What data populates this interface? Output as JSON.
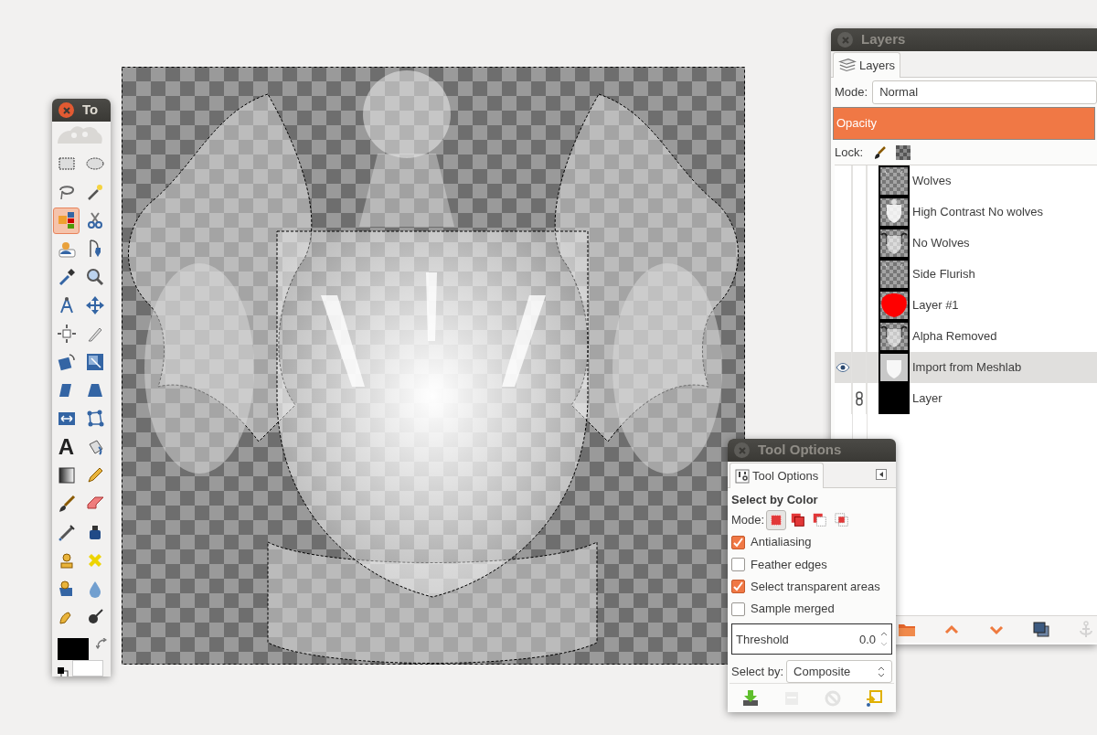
{
  "toolbox": {
    "title": "To",
    "active": true,
    "tools": [
      {
        "kind": "rect_select",
        "selected": false
      },
      {
        "kind": "ellipse_select",
        "selected": false
      },
      {
        "kind": "free_select",
        "selected": false
      },
      {
        "kind": "fuzzy_select",
        "selected": false
      },
      {
        "kind": "by_color_select",
        "selected": true
      },
      {
        "kind": "scissors",
        "selected": false
      },
      {
        "kind": "foreground_select",
        "selected": false
      },
      {
        "kind": "paths",
        "selected": false
      },
      {
        "kind": "color_picker",
        "selected": false
      },
      {
        "kind": "zoom",
        "selected": false
      },
      {
        "kind": "measure",
        "selected": false
      },
      {
        "kind": "move",
        "selected": false
      },
      {
        "kind": "align",
        "selected": false
      },
      {
        "kind": "crop",
        "selected": false
      },
      {
        "kind": "rotate",
        "selected": false
      },
      {
        "kind": "scale",
        "selected": false
      },
      {
        "kind": "shear",
        "selected": false
      },
      {
        "kind": "perspective",
        "selected": false
      },
      {
        "kind": "flip",
        "selected": false
      },
      {
        "kind": "cage",
        "selected": false
      },
      {
        "kind": "text",
        "glyph": "A",
        "selected": false
      },
      {
        "kind": "bucket_fill",
        "selected": false
      },
      {
        "kind": "blend",
        "selected": false
      },
      {
        "kind": "pencil",
        "selected": false
      },
      {
        "kind": "paintbrush",
        "selected": false
      },
      {
        "kind": "eraser",
        "selected": false
      },
      {
        "kind": "airbrush",
        "selected": false
      },
      {
        "kind": "ink",
        "selected": false
      },
      {
        "kind": "clone",
        "selected": false
      },
      {
        "kind": "heal",
        "selected": false
      },
      {
        "kind": "perspective_clone",
        "selected": false
      },
      {
        "kind": "blur",
        "selected": false
      },
      {
        "kind": "smudge",
        "selected": false
      },
      {
        "kind": "dodge_burn",
        "selected": false
      }
    ],
    "colors": [
      {
        "kind": "foreground",
        "color": "#000000"
      },
      {
        "kind": "background",
        "color": "#ffffff"
      }
    ]
  },
  "layers_window": {
    "title": "Layers",
    "active": false,
    "tabs": [
      {
        "label": "Layers",
        "selected": true
      }
    ],
    "mode_label": "Mode:",
    "mode": "Normal",
    "opacity": {
      "label": "Opacity",
      "level": 1
    },
    "lock_label": "Lock:",
    "layers": [
      {
        "name": "Wolves",
        "visible": false,
        "linked": false,
        "selected": false
      },
      {
        "name": "High Contrast No wolves",
        "visible": false,
        "linked": false,
        "selected": false
      },
      {
        "name": "No Wolves",
        "visible": false,
        "linked": false,
        "selected": false
      },
      {
        "name": "Side Flurish",
        "visible": false,
        "linked": false,
        "selected": false
      },
      {
        "name": "Layer #1",
        "visible": false,
        "linked": false,
        "selected": false
      },
      {
        "name": "Alpha Removed",
        "visible": false,
        "linked": false,
        "selected": false
      },
      {
        "name": "Import from Meshlab",
        "visible": true,
        "linked": false,
        "selected": true
      },
      {
        "name": "Layer",
        "visible": false,
        "linked": true,
        "selected": false
      }
    ],
    "buttons": [
      {
        "kind": "folder",
        "disabled": false
      },
      {
        "kind": "raise",
        "disabled": false
      },
      {
        "kind": "lower",
        "disabled": false
      },
      {
        "kind": "duplicate",
        "disabled": false
      },
      {
        "kind": "anchor",
        "disabled": true
      }
    ]
  },
  "tool_options": {
    "title": "Tool Options",
    "active": false,
    "tabs": [
      {
        "label": "Tool Options",
        "selected": true
      }
    ],
    "heading": "Select by Color",
    "mode_label": "Mode:",
    "modes": [
      {
        "kind": "replace",
        "selected": true
      },
      {
        "kind": "add",
        "selected": false
      },
      {
        "kind": "subtract",
        "selected": false
      },
      {
        "kind": "intersect",
        "selected": false
      }
    ],
    "options": [
      {
        "label": "Antialiasing",
        "checked": true
      },
      {
        "label": "Feather edges",
        "checked": false
      },
      {
        "label": "Select transparent areas",
        "checked": true
      },
      {
        "label": "Sample merged",
        "checked": false
      }
    ],
    "threshold": {
      "label": "Threshold",
      "value": "0.0"
    },
    "select_by": {
      "label": "Select by:",
      "value": "Composite"
    },
    "buttons": [
      {
        "kind": "save",
        "disabled": false
      },
      {
        "kind": "restore",
        "disabled": true
      },
      {
        "kind": "delete",
        "disabled": true
      },
      {
        "kind": "reset",
        "disabled": false
      }
    ]
  }
}
